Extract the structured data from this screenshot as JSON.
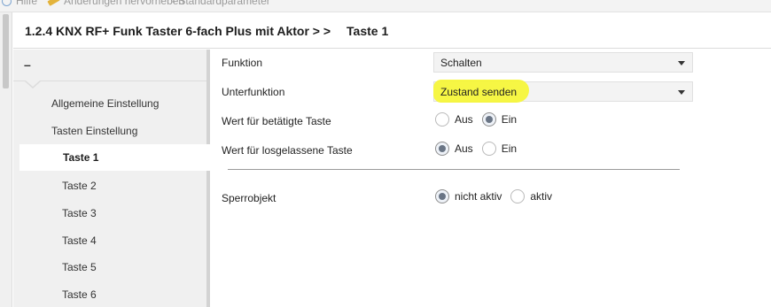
{
  "toolbar": {
    "help_label": "Hilfe",
    "highlight_label": "Änderungen hervorheben",
    "default_label": "Standardparameter"
  },
  "header": {
    "title": "1.2.4 KNX RF+ Funk Taster 6-fach Plus mit Aktor >  >",
    "current": "Taste 1"
  },
  "sidebar": {
    "collapse_label": "–",
    "items": [
      {
        "label": "Allgemeine Einstellung"
      },
      {
        "label": "Tasten Einstellung"
      },
      {
        "label": "Taste 1"
      },
      {
        "label": "Taste 2"
      },
      {
        "label": "Taste 3"
      },
      {
        "label": "Taste 4"
      },
      {
        "label": "Taste 5"
      },
      {
        "label": "Taste 6"
      }
    ]
  },
  "params": {
    "funktion": {
      "label": "Funktion",
      "value": "Schalten"
    },
    "unterfunktion": {
      "label": "Unterfunktion",
      "value": "Zustand senden"
    },
    "wert_betaetigt": {
      "label": "Wert für betätigte Taste",
      "options": [
        "Aus",
        "Ein"
      ],
      "selected": "Ein"
    },
    "wert_losgelassen": {
      "label": "Wert für losgelassene Taste",
      "options": [
        "Aus",
        "Ein"
      ],
      "selected": "Aus"
    },
    "sperrobjekt": {
      "label": "Sperrobjekt",
      "options": [
        "nicht aktiv",
        "aktiv"
      ],
      "selected": "nicht aktiv"
    }
  },
  "colors": {
    "highlight": "#f5f53a",
    "sidebar_bg": "#f0f0f0",
    "active_item_bg": "#ffffff"
  }
}
